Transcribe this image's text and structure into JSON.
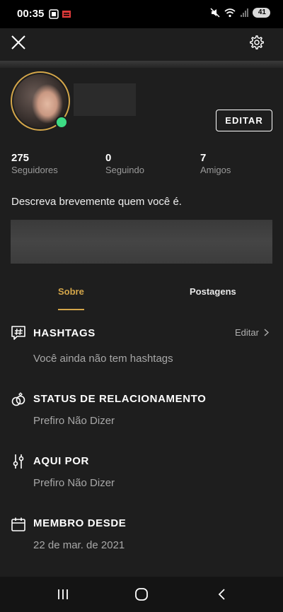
{
  "status_bar": {
    "time": "00:35",
    "battery": "41"
  },
  "topbar": {
    "close_icon": "close-icon",
    "settings_icon": "gear-icon"
  },
  "profile": {
    "edit_label": "EDITAR",
    "online": true,
    "stats": [
      {
        "value": "275",
        "label": "Seguidores"
      },
      {
        "value": "0",
        "label": "Seguindo"
      },
      {
        "value": "7",
        "label": "Amigos"
      }
    ],
    "bio": "Descreva brevemente quem você é."
  },
  "tabs": [
    {
      "label": "Sobre",
      "active": true
    },
    {
      "label": "Postagens",
      "active": false
    }
  ],
  "sections": [
    {
      "title": "HASHTAGS",
      "value": "Você ainda não tem hashtags",
      "icon": "hashtag-chat-icon",
      "action": "Editar"
    },
    {
      "title": "STATUS DE RELACIONAMENTO",
      "value": "Prefiro Não Dizer",
      "icon": "rings-icon"
    },
    {
      "title": "AQUI POR",
      "value": "Prefiro Não Dizer",
      "icon": "sliders-icon"
    },
    {
      "title": "MEMBRO DESDE",
      "value": "22 de mar. de 2021",
      "icon": "calendar-icon"
    }
  ],
  "colors": {
    "accent": "#d4a64a",
    "background": "#1e1e1e",
    "online": "#3ddc84"
  }
}
